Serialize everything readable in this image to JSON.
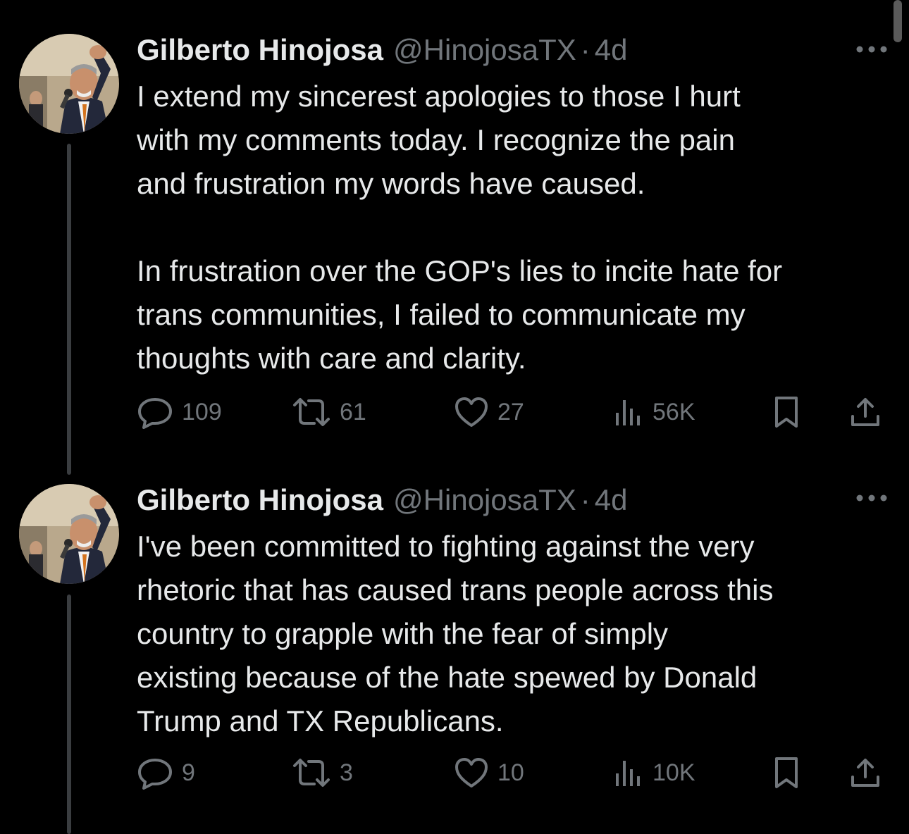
{
  "tweets": [
    {
      "display_name": "Gilberto Hinojosa",
      "handle": "@HinojosaTX",
      "separator": "·",
      "time": "4d",
      "paragraphs": [
        "I extend my sincerest apologies to those I hurt\nwith my comments today. I recognize the pain\nand frustration my words have caused.",
        "In frustration over the GOP's lies to incite hate for\ntrans communities, I failed to communicate my\nthoughts with care and clarity."
      ],
      "replies": "109",
      "retweets": "61",
      "likes": "27",
      "views": "56K"
    },
    {
      "display_name": "Gilberto Hinojosa",
      "handle": "@HinojosaTX",
      "separator": "·",
      "time": "4d",
      "paragraphs": [
        "I've been committed to fighting against the very\nrhetoric that has caused trans people across this\ncountry to grapple with the fear of simply\nexisting because of the hate spewed by Donald\nTrump and TX Republicans."
      ],
      "replies": "9",
      "retweets": "3",
      "likes": "10",
      "views": "10K"
    }
  ],
  "icons": {
    "reply": "reply-icon",
    "retweet": "retweet-icon",
    "like": "like-icon",
    "views": "views-icon",
    "bookmark": "bookmark-icon",
    "share": "share-icon",
    "more": "more-options-icon"
  },
  "colors": {
    "background": "#000000",
    "primary_text": "#e7e9ea",
    "secondary_text": "#71767b",
    "thread_line": "#3a3d40"
  }
}
